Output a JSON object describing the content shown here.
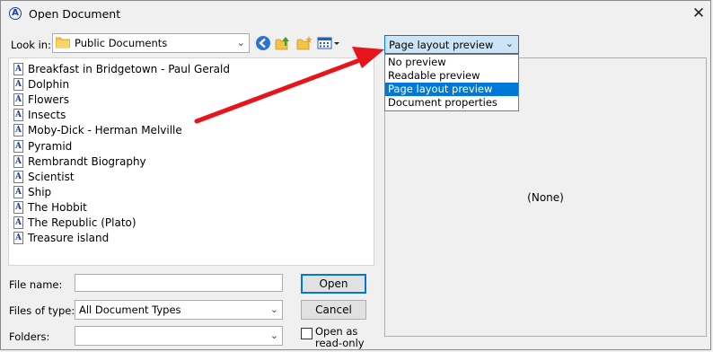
{
  "window": {
    "title": "Open Document",
    "close_glyph": "✕",
    "app_icon_letter": "A"
  },
  "look_in": {
    "label": "Look in:",
    "value": "Public Documents"
  },
  "toolbar": {
    "icons": [
      "back-icon",
      "up-folder-icon",
      "new-folder-icon",
      "view-menu-icon"
    ]
  },
  "files": [
    "Breakfast in Bridgetown - Paul Gerald",
    "Dolphin",
    "Flowers",
    "Insects",
    "Moby-Dick - Herman Melville",
    "Pyramid",
    "Rembrandt Biography",
    "Scientist",
    "Ship",
    "The Hobbit",
    "The Republic (Plato)",
    "Treasure island"
  ],
  "form": {
    "file_name_label": "File name:",
    "file_name_value": "",
    "files_of_type_label": "Files of type:",
    "files_of_type_value": "All Document Types",
    "folders_label": "Folders:",
    "folders_value": ""
  },
  "buttons": {
    "open": "Open",
    "cancel": "Cancel"
  },
  "open_readonly": {
    "line1": "Open as",
    "line2": "read-only",
    "checked": false
  },
  "preview": {
    "selected": "Page layout preview",
    "options": [
      "No preview",
      "Readable preview",
      "Page layout preview",
      "Document properties"
    ],
    "selected_index": 2,
    "empty_text": "(None)"
  },
  "colors": {
    "accent": "#0078d7",
    "arrow": "#e8141b"
  }
}
